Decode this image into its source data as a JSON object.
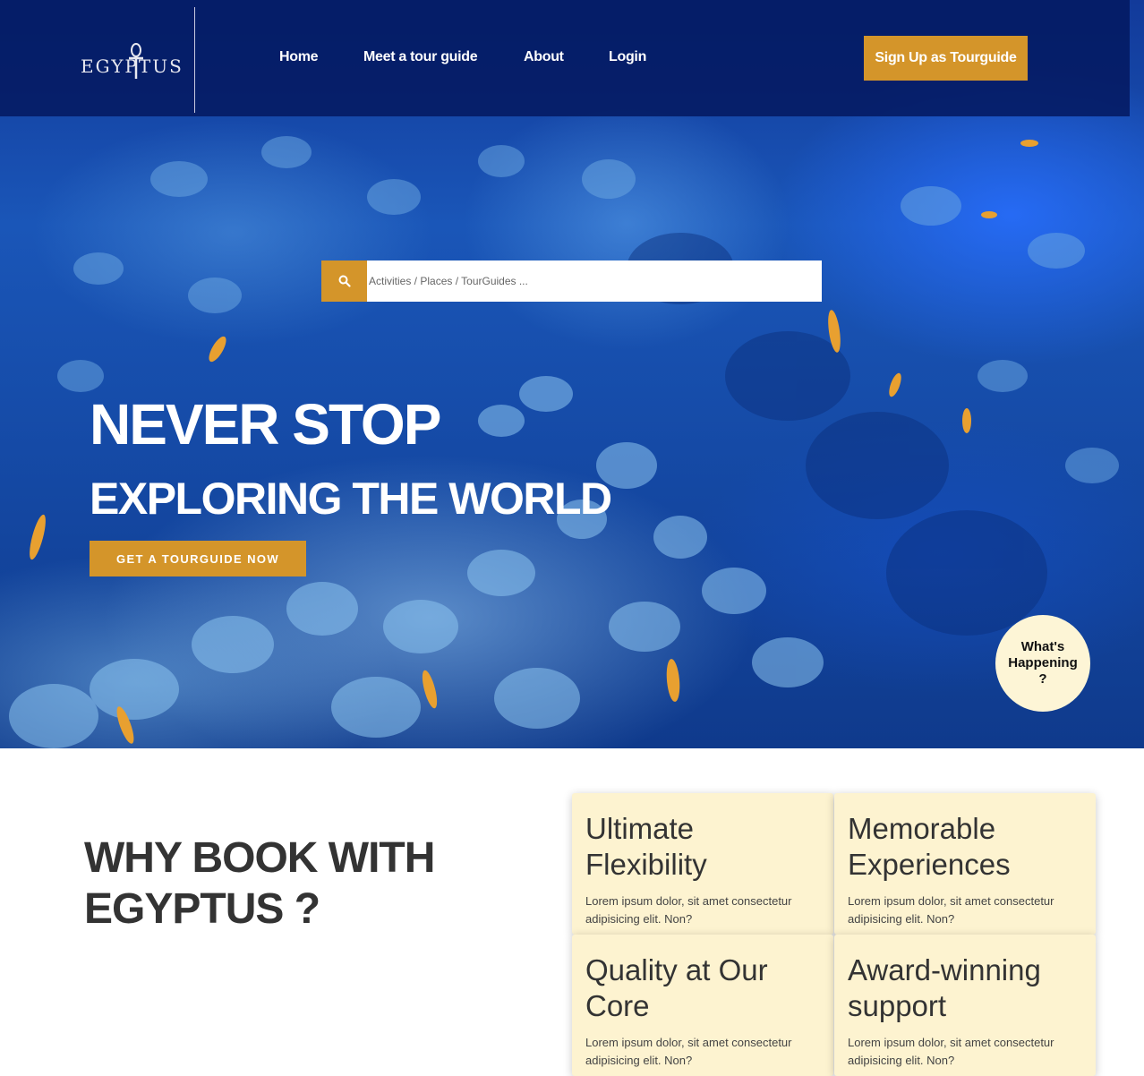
{
  "nav": {
    "logo_text": "EGYPTUS",
    "links": [
      "Home",
      "Meet a tour guide",
      "About",
      "Login"
    ],
    "signup_label": "Sign Up as Tourguide"
  },
  "search": {
    "placeholder": "Activities / Places / TourGuides ..."
  },
  "hero": {
    "headline": "NEVER STOP",
    "subheadline": "EXPLORING THE WORLD",
    "cta_label": "GET A TOURGUIDE NOW"
  },
  "whats_happening": {
    "label": "What's Happening ?"
  },
  "why": {
    "title": "WHY BOOK WITH EGYPTUS ?",
    "cards": [
      {
        "title": "Ultimate Flexibility",
        "text": "Lorem ipsum dolor, sit amet consectetur adipisicing elit. Non?"
      },
      {
        "title": "Memorable Experiences",
        "text": "Lorem ipsum dolor, sit amet consectetur adipisicing elit. Non?"
      },
      {
        "title": "Quality at Our Core",
        "text": "Lorem ipsum dolor, sit amet consectetur adipisicing elit. Non?"
      },
      {
        "title": "Award-winning support",
        "text": "Lorem ipsum dolor, sit amet consectetur adipisicing elit. Non?"
      }
    ]
  },
  "colors": {
    "accent": "#d4952a",
    "navbar": "#03195f",
    "card_bg": "#fdf3d0",
    "bubble_bg": "#fdf5d6"
  },
  "icons": {
    "search": "search-icon",
    "logo_mark": "ankh-icon"
  }
}
